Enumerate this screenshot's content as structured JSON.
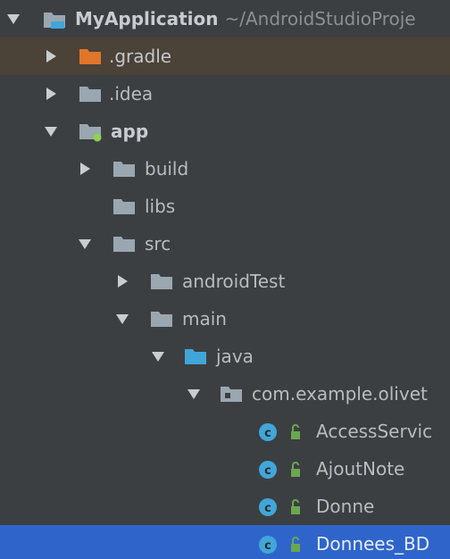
{
  "project_tree": {
    "root": {
      "label": "MyApplication",
      "path": "~/AndroidStudioProje"
    },
    "items": [
      {
        "label": ".gradle",
        "kind": "folder-excluded",
        "state": "collapsed"
      },
      {
        "label": ".idea",
        "kind": "folder",
        "state": "collapsed"
      },
      {
        "label": "app",
        "kind": "module",
        "state": "expanded"
      },
      {
        "label": "build",
        "kind": "folder",
        "state": "collapsed"
      },
      {
        "label": "libs",
        "kind": "folder",
        "state": "leaf"
      },
      {
        "label": "src",
        "kind": "folder",
        "state": "expanded"
      },
      {
        "label": "androidTest",
        "kind": "folder",
        "state": "collapsed"
      },
      {
        "label": "main",
        "kind": "folder",
        "state": "expanded"
      },
      {
        "label": "java",
        "kind": "source-folder",
        "state": "expanded"
      },
      {
        "label": "com.example.olivet",
        "kind": "package",
        "state": "expanded"
      },
      {
        "label": "AccessServic",
        "kind": "class",
        "state": "leaf"
      },
      {
        "label": "AjoutNote",
        "kind": "class",
        "state": "leaf"
      },
      {
        "label": "Donne",
        "kind": "class",
        "state": "leaf"
      },
      {
        "label": "Donnees_BD",
        "kind": "class",
        "state": "leaf"
      }
    ],
    "colors": {
      "panel_bg": "#3c3f41",
      "highlight_row": "#4b4238",
      "selected_row": "#2f65ca",
      "folder": "#9aa7b0",
      "folder_excluded": "#e0762b",
      "source_folder": "#40a6d9",
      "class_icon": "#41a6d9",
      "access_lock": "#6aa84f"
    }
  }
}
